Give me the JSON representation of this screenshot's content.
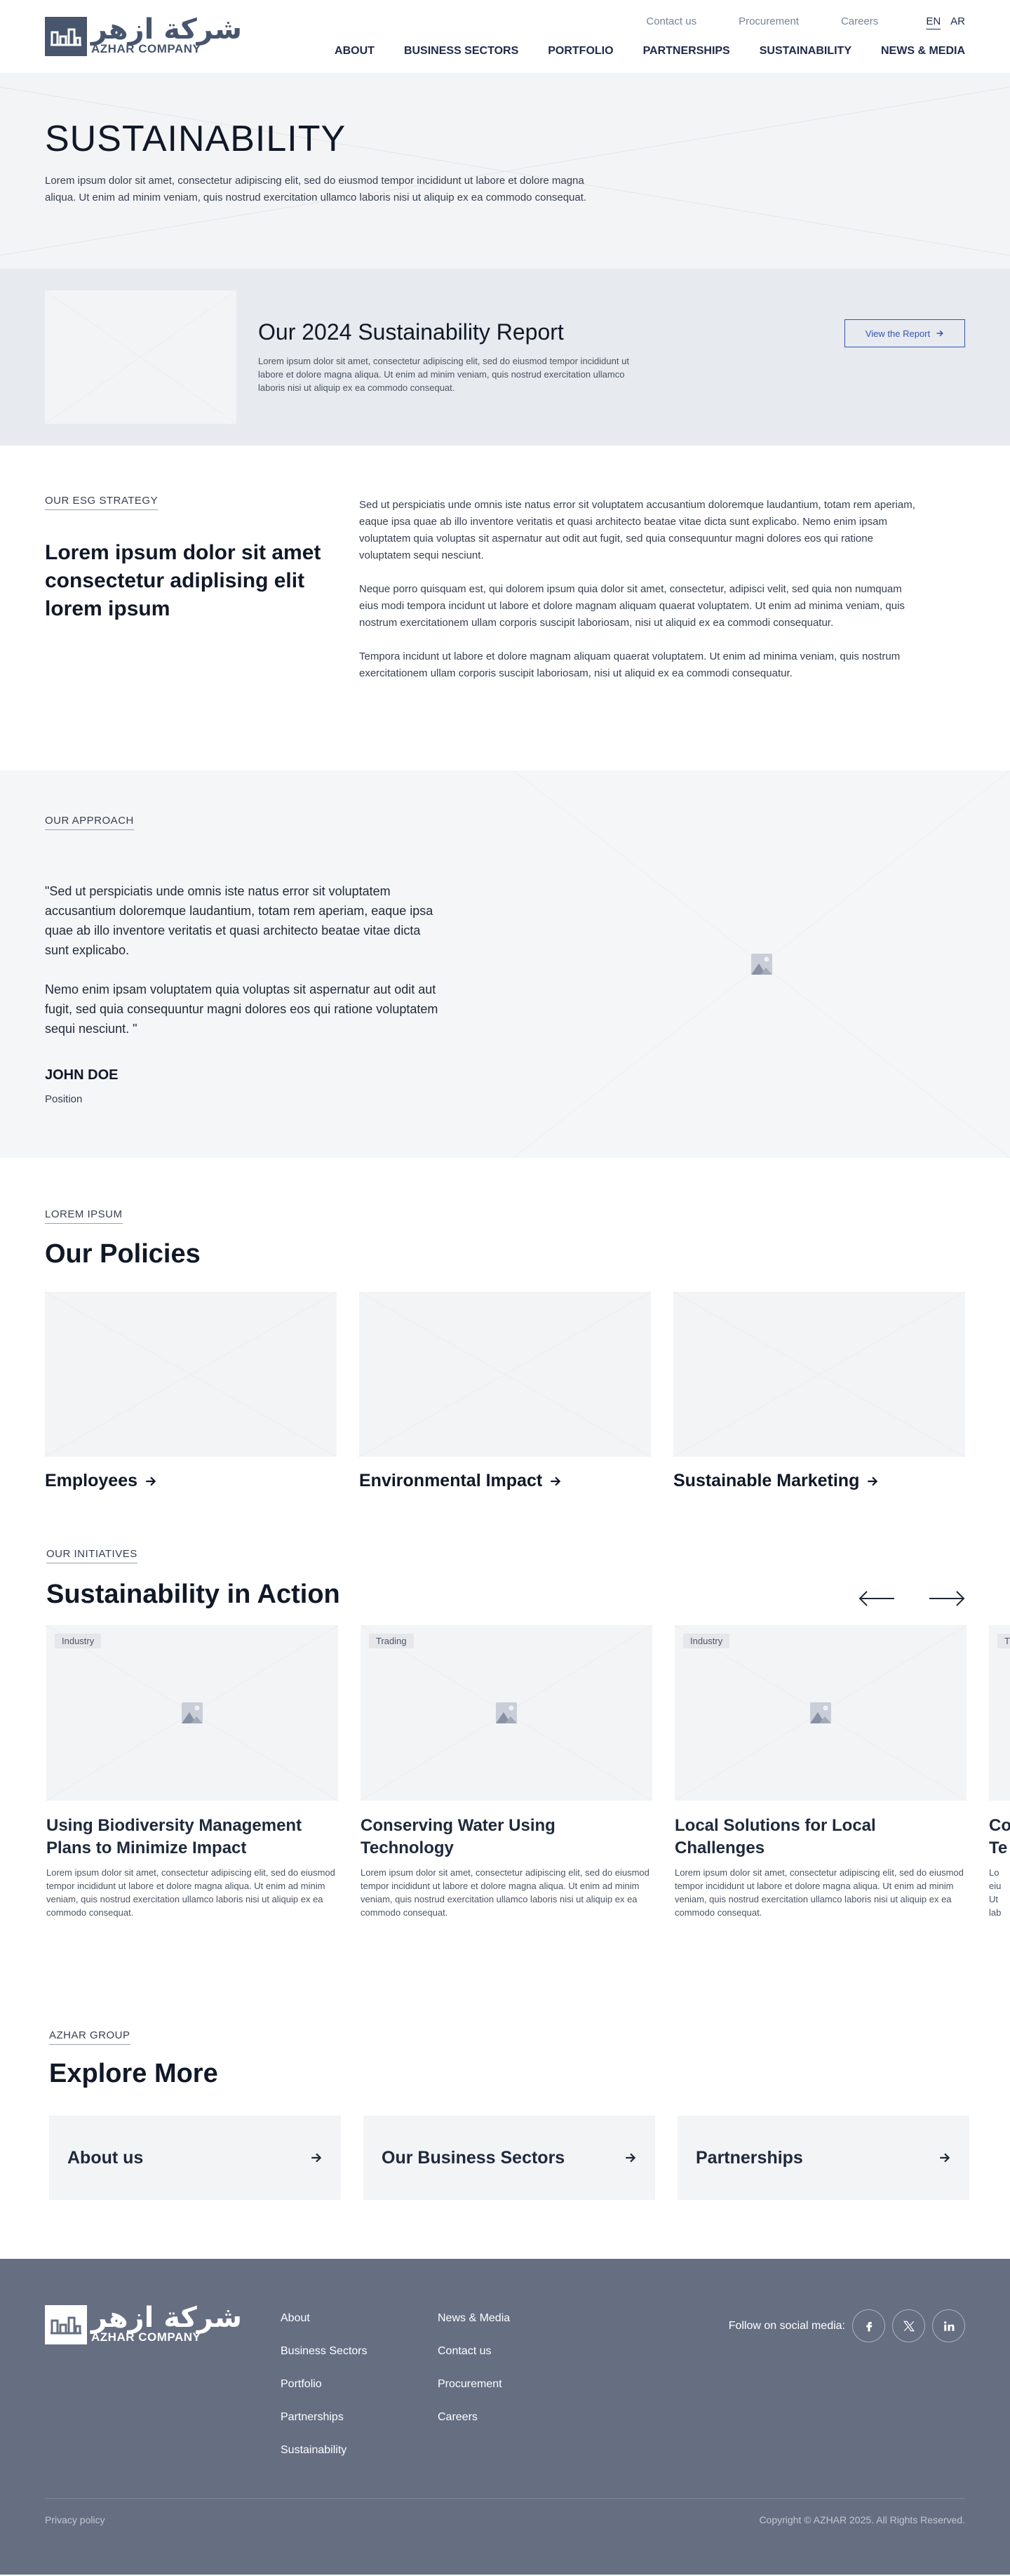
{
  "header": {
    "logo_ar": "شركة ازهر",
    "logo_en": "AZHAR COMPANY",
    "utility": [
      "Contact us",
      "Procurement",
      "Careers"
    ],
    "lang": [
      "EN",
      "AR"
    ],
    "nav": [
      "ABOUT",
      "BUSINESS SECTORS",
      "PORTFOLIO",
      "PARTNERSHIPS",
      "SUSTAINABILITY",
      "NEWS & MEDIA"
    ]
  },
  "hero": {
    "title": "SUSTAINABILITY",
    "text": "Lorem ipsum dolor sit amet, consectetur adipiscing elit, sed do eiusmod tempor incididunt ut labore et dolore magna aliqua. Ut enim ad minim veniam, quis nostrud exercitation ullamco laboris nisi ut aliquip ex ea commodo consequat."
  },
  "report": {
    "title": "Our 2024 Sustainability Report",
    "text": "Lorem ipsum dolor sit amet, consectetur adipiscing elit, sed do eiusmod tempor incididunt ut labore et dolore magna aliqua. Ut enim ad minim veniam, quis nostrud exercitation ullamco laboris nisi ut aliquip ex ea commodo consequat.",
    "button": "View the Report"
  },
  "esg": {
    "eyebrow": "OUR ESG STRATEGY",
    "heading": "Lorem ipsum dolor sit amet consectetur adiplising elit lorem ipsum",
    "paragraphs": [
      "Sed ut perspiciatis unde omnis iste natus error sit voluptatem accusantium doloremque laudantium, totam rem aperiam, eaque ipsa quae ab illo inventore veritatis et quasi architecto beatae vitae dicta sunt explicabo. Nemo enim ipsam voluptatem quia voluptas sit aspernatur aut odit aut fugit, sed quia consequuntur magni dolores eos qui ratione voluptatem sequi nesciunt.",
      "Neque porro quisquam est, qui dolorem ipsum quia dolor sit amet, consectetur, adipisci velit, sed quia non numquam eius modi tempora incidunt ut labore et dolore magnam aliquam quaerat voluptatem. Ut enim ad minima veniam, quis nostrum exercitationem ullam corporis suscipit laboriosam, nisi ut aliquid ex ea commodi consequatur.",
      "Tempora incidunt ut labore et dolore magnam aliquam quaerat voluptatem. Ut enim ad minima veniam, quis nostrum exercitationem ullam corporis suscipit laboriosam, nisi ut aliquid ex ea commodi consequatur."
    ]
  },
  "approach": {
    "eyebrow": "OUR APPROACH",
    "quote": [
      "\"Sed ut perspiciatis unde omnis iste natus error sit voluptatem accusantium doloremque laudantium, totam rem aperiam, eaque ipsa quae ab illo inventore veritatis et quasi architecto beatae vitae dicta sunt explicabo.",
      "Nemo enim ipsam voluptatem quia voluptas sit aspernatur aut odit aut fugit, sed quia consequuntur magni dolores eos qui ratione voluptatem sequi nesciunt. \""
    ],
    "name": "JOHN DOE",
    "position": "Position"
  },
  "policies": {
    "eyebrow": "LOREM IPSUM",
    "title": "Our Policies",
    "items": [
      "Employees",
      "Environmental Impact",
      "Sustainable Marketing"
    ]
  },
  "initiatives": {
    "eyebrow": "OUR INITIATIVES",
    "title": "Sustainability in Action",
    "cards": [
      {
        "tag": "Industry",
        "title": "Using Biodiversity Management Plans to Minimize Impact",
        "text": "Lorem ipsum dolor sit amet, consectetur adipiscing elit, sed do eiusmod tempor incididunt ut labore et dolore magna aliqua. Ut enim ad minim veniam, quis nostrud exercitation ullamco laboris nisi ut aliquip ex ea commodo consequat."
      },
      {
        "tag": "Trading",
        "title": "Conserving Water Using Technology",
        "text": "Lorem ipsum dolor sit amet, consectetur adipiscing elit, sed do eiusmod tempor incididunt ut labore et dolore magna aliqua. Ut enim ad minim veniam, quis nostrud exercitation ullamco laboris nisi ut aliquip ex ea commodo consequat."
      },
      {
        "tag": "Industry",
        "title": "Local Solutions for Local Challenges",
        "text": "Lorem ipsum dolor sit amet, consectetur adipiscing elit, sed do eiusmod tempor incididunt ut labore et dolore magna aliqua. Ut enim ad minim veniam, quis nostrud exercitation ullamco laboris nisi ut aliquip ex ea commodo consequat."
      },
      {
        "tag": "T",
        "title": "Co Te",
        "text": "Lo eiu Ut lab"
      }
    ]
  },
  "explore": {
    "eyebrow": "AZHAR GROUP",
    "title": "Explore More",
    "items": [
      "About us",
      "Our Business Sectors",
      "Partnerships"
    ]
  },
  "footer": {
    "col1": [
      "About",
      "Business Sectors",
      "Portfolio",
      "Partnerships",
      "Sustainability"
    ],
    "col2": [
      "News & Media",
      "Contact us",
      "Procurement",
      "Careers"
    ],
    "social_label": "Follow on social media:",
    "social_icons": [
      "facebook-icon",
      "x-icon",
      "linkedin-icon"
    ],
    "privacy": "Privacy policy",
    "copyright": "Copyright © AZHAR 2025. All Rights Reserved."
  }
}
